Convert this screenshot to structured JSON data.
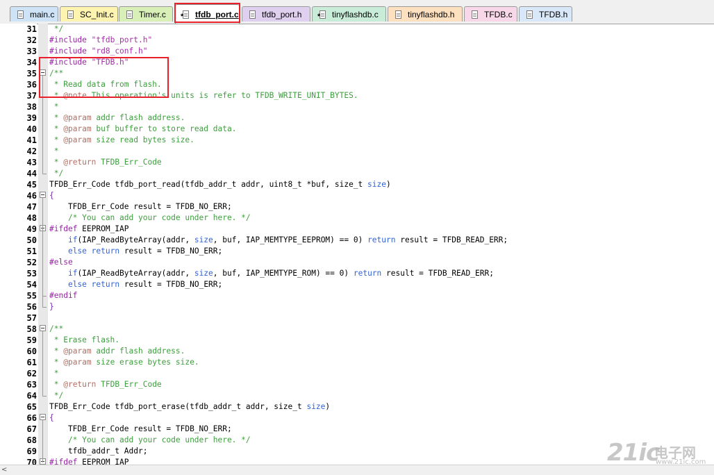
{
  "tabs": [
    {
      "label": "main.c",
      "color": "#cfe3f7",
      "modified": false
    },
    {
      "label": "SC_Init.c",
      "color": "#fff3b0",
      "modified": false
    },
    {
      "label": "Timer.c",
      "color": "#d8f0b8",
      "modified": false
    },
    {
      "label": "tfdb_port.c",
      "color": "#ffffff",
      "modified": true,
      "active": true
    },
    {
      "label": "tfdb_port.h",
      "color": "#e0d0f0",
      "modified": false
    },
    {
      "label": "tinyflashdb.c",
      "color": "#c8ecd8",
      "modified": true
    },
    {
      "label": "tinyflashdb.h",
      "color": "#fde0c0",
      "modified": false
    },
    {
      "label": "TFDB.c",
      "color": "#f8d8e8",
      "modified": false
    },
    {
      "label": "TFDB.h",
      "color": "#d8e8f8",
      "modified": false
    }
  ],
  "editor": {
    "lines": [
      {
        "n": "31",
        "text": " */"
      },
      {
        "n": "32",
        "text": "#include \"tfdb_port.h\""
      },
      {
        "n": "33",
        "text": "#include \"rd8_conf.h\""
      },
      {
        "n": "34",
        "text": "#include \"TFDB.h\""
      },
      {
        "n": "35",
        "text": "/**",
        "fold": true
      },
      {
        "n": "36",
        "text": " * Read data from flash."
      },
      {
        "n": "37",
        "text": " * @note This operation's units is refer to TFDB_WRITE_UNIT_BYTES."
      },
      {
        "n": "38",
        "text": " *"
      },
      {
        "n": "39",
        "text": " * @param addr flash address."
      },
      {
        "n": "40",
        "text": " * @param buf buffer to store read data."
      },
      {
        "n": "41",
        "text": " * @param size read bytes size."
      },
      {
        "n": "42",
        "text": " *"
      },
      {
        "n": "43",
        "text": " * @return TFDB_Err_Code"
      },
      {
        "n": "44",
        "text": " */"
      },
      {
        "n": "45",
        "text": "TFDB_Err_Code tfdb_port_read(tfdb_addr_t addr, uint8_t *buf, size_t size)"
      },
      {
        "n": "46",
        "text": "{",
        "fold": true
      },
      {
        "n": "47",
        "text": "    TFDB_Err_Code result = TFDB_NO_ERR;"
      },
      {
        "n": "48",
        "text": "    /* You can add your code under here. */"
      },
      {
        "n": "49",
        "text": "#ifdef EEPROM_IAP",
        "fold": true
      },
      {
        "n": "50",
        "text": "    if(IAP_ReadByteArray(addr, size, buf, IAP_MEMTYPE_EEPROM) == 0) return result = TFDB_READ_ERR;"
      },
      {
        "n": "51",
        "text": "    else return result = TFDB_NO_ERR;"
      },
      {
        "n": "52",
        "text": "#else"
      },
      {
        "n": "53",
        "text": "    if(IAP_ReadByteArray(addr, size, buf, IAP_MEMTYPE_ROM) == 0) return result = TFDB_READ_ERR;"
      },
      {
        "n": "54",
        "text": "    else return result = TFDB_NO_ERR;"
      },
      {
        "n": "55",
        "text": "#endif"
      },
      {
        "n": "56",
        "text": "}"
      },
      {
        "n": "57",
        "text": ""
      },
      {
        "n": "58",
        "text": "/**",
        "fold": true
      },
      {
        "n": "59",
        "text": " * Erase flash."
      },
      {
        "n": "60",
        "text": " * @param addr flash address."
      },
      {
        "n": "61",
        "text": " * @param size erase bytes size."
      },
      {
        "n": "62",
        "text": " *"
      },
      {
        "n": "63",
        "text": " * @return TFDB_Err_Code"
      },
      {
        "n": "64",
        "text": " */"
      },
      {
        "n": "65",
        "text": "TFDB_Err_Code tfdb_port_erase(tfdb_addr_t addr, size_t size)"
      },
      {
        "n": "66",
        "text": "{",
        "fold": true
      },
      {
        "n": "67",
        "text": "    TFDB_Err_Code result = TFDB_NO_ERR;"
      },
      {
        "n": "68",
        "text": "    /* You can add your code under here. */"
      },
      {
        "n": "69",
        "text": "    tfdb_addr_t Addr;"
      },
      {
        "n": "70",
        "text": "#ifdef EEPROM_IAP",
        "fold": true
      }
    ]
  },
  "watermark": {
    "logo": "21ic",
    "cn": "电子网",
    "url": "www.21ic.com"
  },
  "colors": {
    "highlight": "#e8202a",
    "comment": "#3c9e3c",
    "keyword": "#2f63d6",
    "preprocessor": "#9b1fa8"
  }
}
